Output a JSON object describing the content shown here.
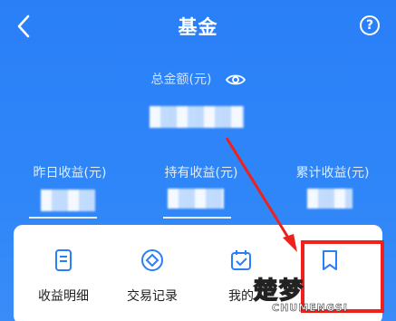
{
  "header": {
    "title": "基金",
    "back_icon": "chevron-left-icon",
    "help_icon": "question-circle-icon"
  },
  "summary": {
    "total_label": "总金额(元)",
    "eye_icon": "eye-icon"
  },
  "stats": [
    {
      "label": "昨日收益(元)"
    },
    {
      "label": "持有收益(元)"
    },
    {
      "label": "累计收益(元)"
    }
  ],
  "menu": [
    {
      "label": "收益明细",
      "icon": "document-icon"
    },
    {
      "label": "交易记录",
      "icon": "diamond-circle-icon"
    },
    {
      "label": "我的",
      "icon": "calendar-check-icon"
    },
    {
      "label": "",
      "icon": "bookmark-icon"
    }
  ],
  "watermark": {
    "cn": "楚梦",
    "en": "CHUMENGSI"
  },
  "colors": {
    "primary": "#2a7ff7",
    "highlight": "#f0201c"
  }
}
